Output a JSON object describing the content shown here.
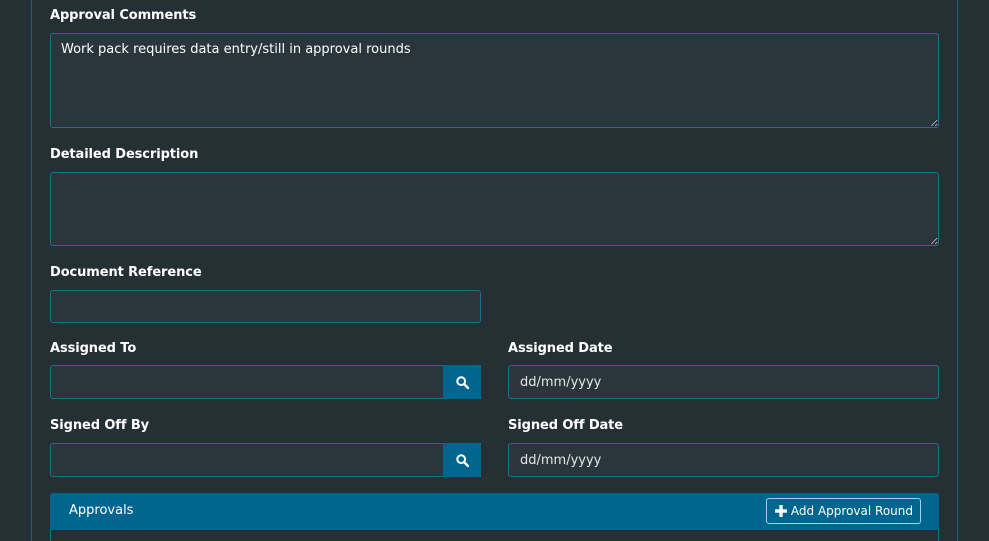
{
  "approval_comments": {
    "label": "Approval Comments",
    "value": "Work pack requires data entry/still in approval rounds"
  },
  "detailed_description": {
    "label": "Detailed Description",
    "value": ""
  },
  "document_reference": {
    "label": "Document Reference",
    "value": ""
  },
  "assigned_to": {
    "label": "Assigned To",
    "value": "",
    "icon": "search-icon"
  },
  "assigned_date": {
    "label": "Assigned Date",
    "placeholder": "dd/mm/yyyy"
  },
  "signed_off_by": {
    "label": "Signed Off By",
    "value": "",
    "icon": "search-icon"
  },
  "signed_off_date": {
    "label": "Signed Off Date",
    "placeholder": "dd/mm/yyyy"
  },
  "approvals_panel": {
    "title": "Approvals",
    "add_button_label": "Add Approval Round",
    "add_icon": "plus-icon"
  },
  "colors": {
    "background": "#253035",
    "field_background": "#2b363c",
    "field_border": "#1a6f92",
    "accent": "#00668f"
  }
}
